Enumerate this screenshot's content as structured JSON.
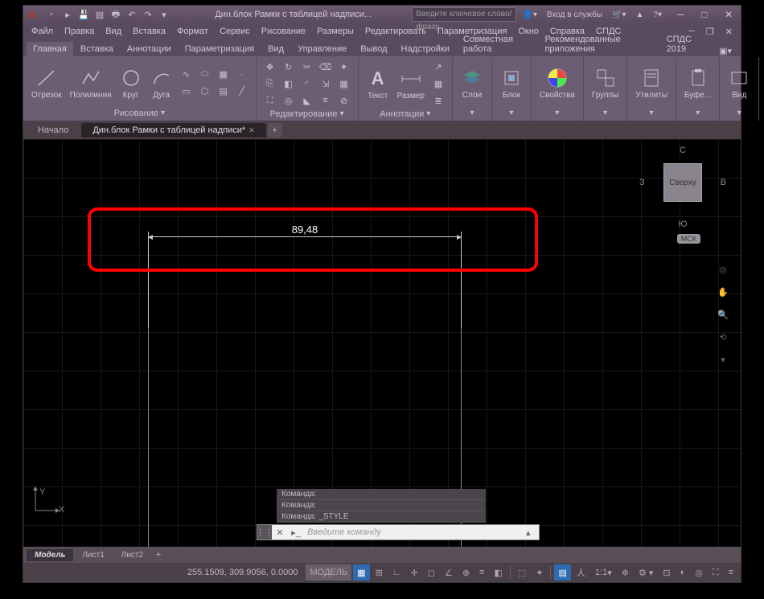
{
  "title": "Дин.блок Рамки с таблицей надписи...",
  "search_placeholder": "Введите ключевое слово/фразу",
  "signin": "Вход в службы",
  "menus": [
    "Файл",
    "Правка",
    "Вид",
    "Вставка",
    "Формат",
    "Сервис",
    "Рисование",
    "Размеры",
    "Редактировать",
    "Параметризация",
    "Окно",
    "Справка",
    "СПДС"
  ],
  "ribbon_tabs": [
    "Главная",
    "Вставка",
    "Аннотации",
    "Параметризация",
    "Вид",
    "Управление",
    "Вывод",
    "Надстройки",
    "Совместная работа",
    "Рекомендованные приложения",
    "СПДС 2019"
  ],
  "panels": {
    "draw": {
      "title": "Рисование",
      "items": [
        "Отрезок",
        "Полилиния",
        "Круг",
        "Дуга"
      ]
    },
    "edit": {
      "title": "Редактирование"
    },
    "annot": {
      "title": "Аннотации",
      "items": [
        "Текст",
        "Размер"
      ]
    },
    "layers": {
      "title": "Слои"
    },
    "block": {
      "title": "Блок"
    },
    "props": {
      "title": "Свойства"
    },
    "groups": {
      "title": "Группы"
    },
    "utils": {
      "title": "Утилиты"
    },
    "clip": {
      "title": "Буфе..."
    },
    "view": {
      "title": "Вид"
    }
  },
  "doc_tabs": {
    "start": "Начало",
    "active": "Дин.блок Рамки с таблицей надписи*"
  },
  "dimension_value": "89,48",
  "viewcube": {
    "face": "Сверху",
    "n": "С",
    "s": "Ю",
    "e": "В",
    "w": "З",
    "badge": "МСК"
  },
  "ucs": {
    "x": "X",
    "y": "Y"
  },
  "cmd_history": [
    "Команда:",
    "Команда:",
    "Команда: _STYLE"
  ],
  "cmd_placeholder": "Введите команду",
  "layout_tabs": [
    "Модель",
    "Лист1",
    "Лист2"
  ],
  "status": {
    "coords": "255.1509, 309.9056, 0.0000",
    "model": "МОДЕЛЬ",
    "scale": "1:1"
  }
}
